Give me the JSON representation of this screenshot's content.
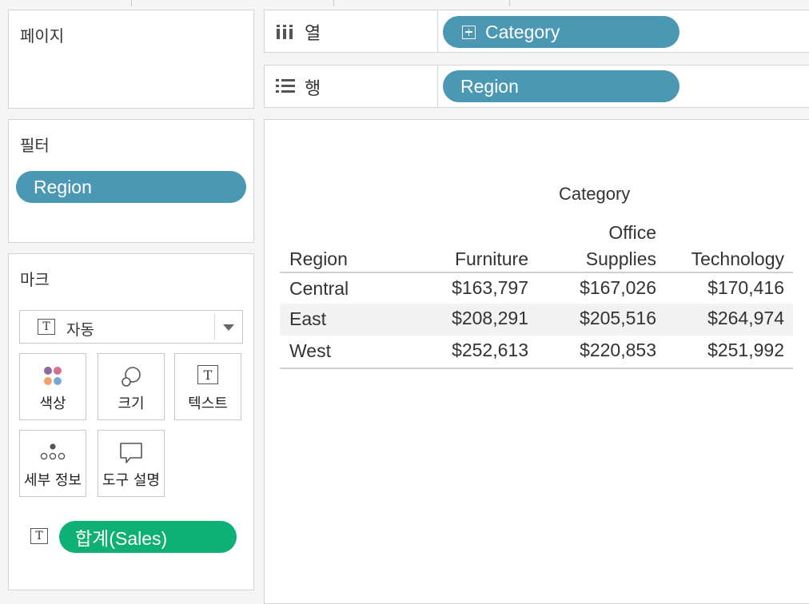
{
  "pages_card": {
    "title": "페이지"
  },
  "shelves": {
    "columns": {
      "label": "열",
      "pill": "Category"
    },
    "rows": {
      "label": "행",
      "pill": "Region"
    }
  },
  "filters_card": {
    "title": "필터",
    "pill": "Region"
  },
  "marks_card": {
    "title": "마크",
    "mark_type": "자동",
    "buttons": {
      "color": "색상",
      "size": "크기",
      "text": "텍스트",
      "detail": "세부 정보",
      "tooltip": "도구 설명"
    },
    "measure_pill": "합계(Sales)"
  },
  "colors": {
    "dimension_pill": "#4a98b3",
    "measure_pill": "#0fb076"
  },
  "table": {
    "column_header_title": "Category",
    "row_header_title": "Region",
    "columns": [
      "Furniture",
      "Office Supplies",
      "Technology"
    ],
    "office_supplies_line1": "Office",
    "office_supplies_line2": "Supplies",
    "rows": [
      {
        "region": "Central",
        "values": [
          "$163,797",
          "$167,026",
          "$170,416"
        ]
      },
      {
        "region": "East",
        "values": [
          "$208,291",
          "$205,516",
          "$264,974"
        ]
      },
      {
        "region": "West",
        "values": [
          "$252,613",
          "$220,853",
          "$251,992"
        ]
      }
    ]
  }
}
